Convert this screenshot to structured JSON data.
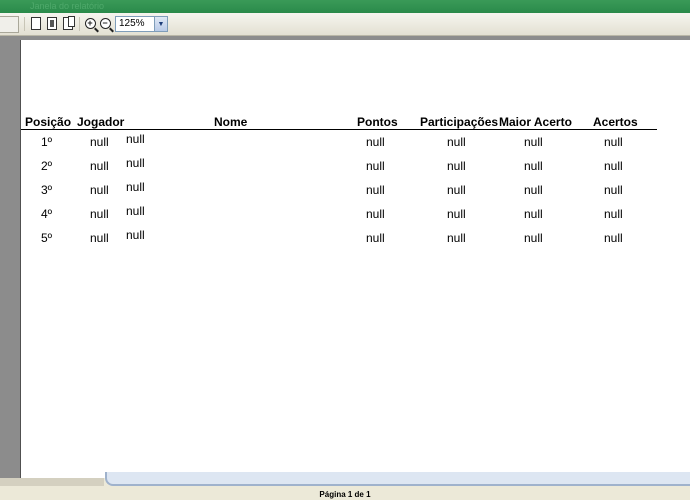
{
  "window": {
    "title_faint": "Janela do relatório"
  },
  "toolbar": {
    "zoom_value": "125%",
    "buttons": [
      "single-page",
      "two-pages",
      "three-pages",
      "zoom-in",
      "zoom-out"
    ]
  },
  "report": {
    "columns": {
      "posicao": "Posição",
      "jogador": "Jogador",
      "nome": "Nome",
      "pontos": "Pontos",
      "participacoes": "Participações",
      "maior_acerto": "Maior Acerto",
      "acertos": "Acertos"
    },
    "rows": [
      {
        "posicao": "1º",
        "jogador": "null",
        "nome": "null",
        "pontos": "null",
        "participacoes": "null",
        "maior_acerto": "null",
        "acertos": "null"
      },
      {
        "posicao": "2º",
        "jogador": "null",
        "nome": "null",
        "pontos": "null",
        "participacoes": "null",
        "maior_acerto": "null",
        "acertos": "null"
      },
      {
        "posicao": "3º",
        "jogador": "null",
        "nome": "null",
        "pontos": "null",
        "participacoes": "null",
        "maior_acerto": "null",
        "acertos": "null"
      },
      {
        "posicao": "4º",
        "jogador": "null",
        "nome": "null",
        "pontos": "null",
        "participacoes": "null",
        "maior_acerto": "null",
        "acertos": "null"
      },
      {
        "posicao": "5º",
        "jogador": "null",
        "nome": "null",
        "pontos": "null",
        "participacoes": "null",
        "maior_acerto": "null",
        "acertos": "null"
      }
    ]
  },
  "status": {
    "page_label": "Página 1 de 1"
  }
}
